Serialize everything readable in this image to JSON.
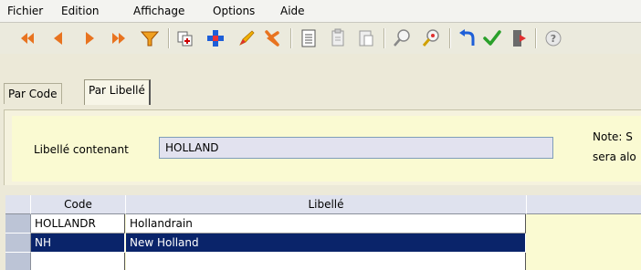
{
  "menu": {
    "items": [
      "Fichier",
      "Edition",
      "Affichage",
      "Options",
      "Aide"
    ]
  },
  "toolbar": {
    "icons": [
      "first-record-icon",
      "previous-record-icon",
      "next-record-icon",
      "last-record-icon",
      "filter-icon",
      "duplicate-icon",
      "add-icon",
      "edit-icon",
      "delete-icon",
      "list-icon",
      "copy-icon",
      "paste-icon",
      "search-icon",
      "find-icon",
      "undo-icon",
      "validate-icon",
      "exit-icon",
      "help-icon"
    ]
  },
  "tabs": {
    "code": "Par Code",
    "libelle": "Par Libellé"
  },
  "search": {
    "label": "Libellé contenant",
    "value": "HOLLAND"
  },
  "note": {
    "line1": "Note: S",
    "line2": "sera alo"
  },
  "grid": {
    "columns": [
      "Code",
      "Libellé"
    ],
    "rows": [
      {
        "code": "HOLLANDR",
        "libelle": "Hollandrain",
        "selected": false
      },
      {
        "code": "NH",
        "libelle": "New Holland",
        "selected": true
      }
    ]
  },
  "colors": {
    "selection": "#0a246a",
    "panel": "#fafad2",
    "header": "#dfe2ee"
  }
}
